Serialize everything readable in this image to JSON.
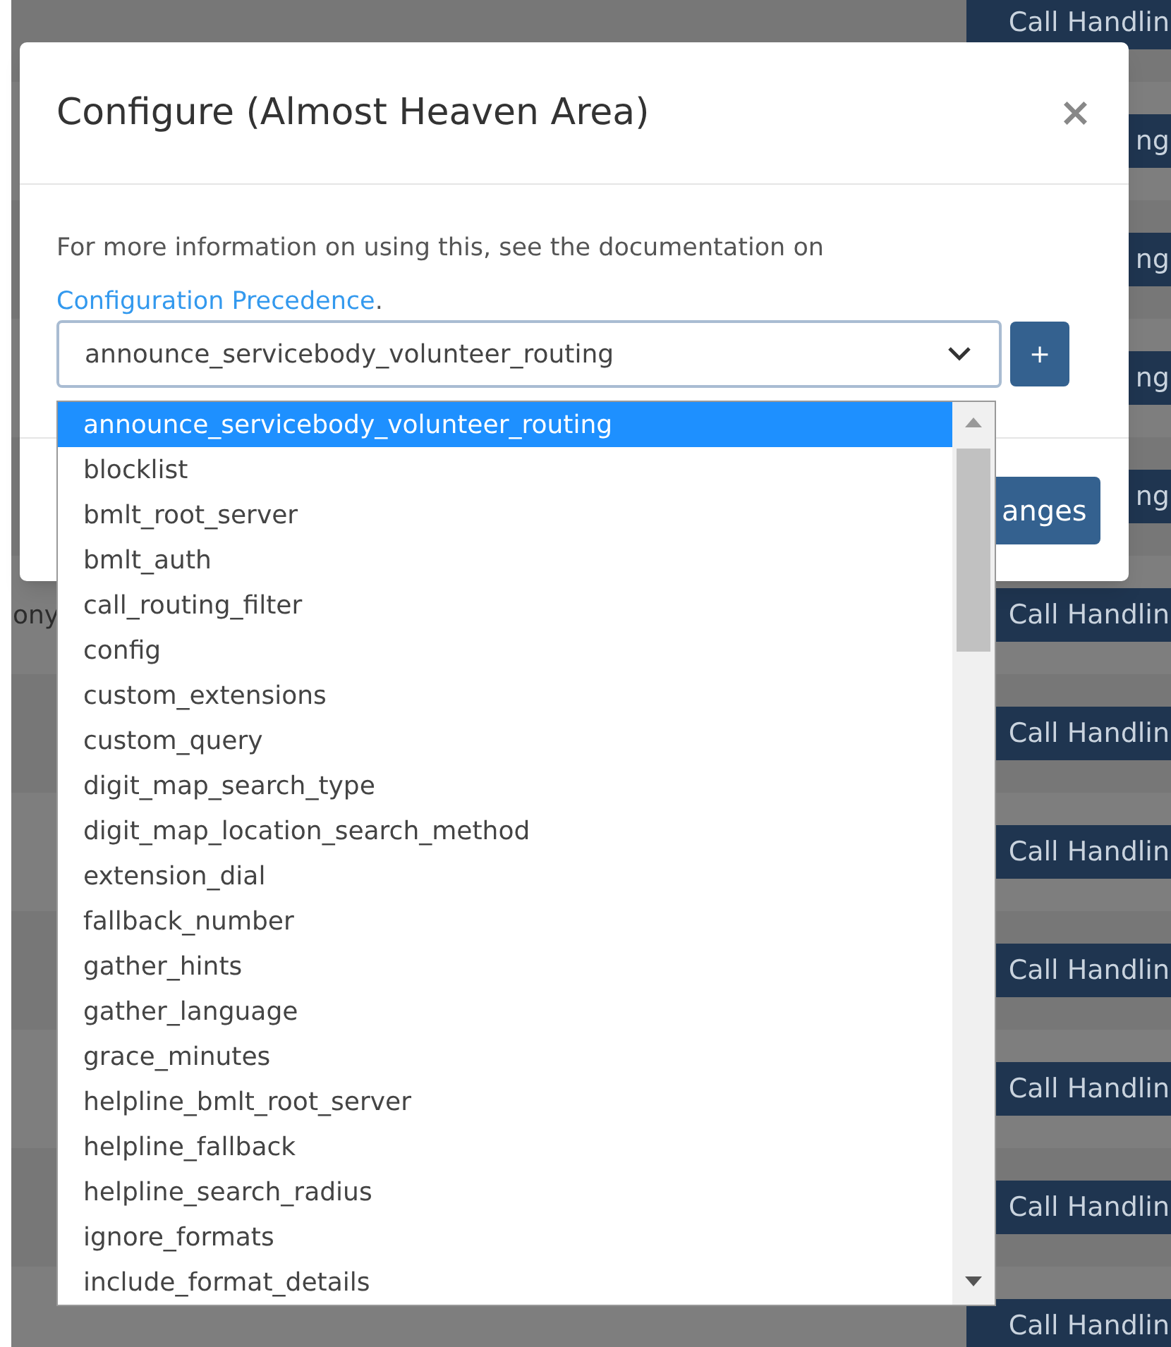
{
  "page_rows": [
    {
      "button": "Call Handlin"
    },
    {
      "button": "ng"
    },
    {
      "button": "ng"
    },
    {
      "button": "ng"
    },
    {
      "button": "ng"
    },
    {
      "text": "ony",
      "button": "Call Handlin"
    },
    {
      "button": "Call Handlin"
    },
    {
      "button": "Call Handlin"
    },
    {
      "button": "Call Handlin"
    },
    {
      "button": "Call Handlin"
    },
    {
      "button": "Call Handlin"
    },
    {
      "button": "Call Handlin"
    }
  ],
  "dialog": {
    "title": "Configure (Almost Heaven Area)",
    "close": "×",
    "description": "For more information on using this, see the documentation on",
    "link": "Configuration Precedence",
    "link_suffix": ".",
    "add_button": "+",
    "save_button": "anges",
    "select": {
      "value": "announce_servicebody_volunteer_routing",
      "options": [
        {
          "label": "announce_servicebody_volunteer_routing",
          "selected": true
        },
        {
          "label": "blocklist",
          "selected": false
        },
        {
          "label": "bmlt_root_server",
          "selected": false
        },
        {
          "label": "bmlt_auth",
          "selected": false
        },
        {
          "label": "call_routing_filter",
          "selected": false
        },
        {
          "label": "config",
          "selected": false
        },
        {
          "label": "custom_extensions",
          "selected": false
        },
        {
          "label": "custom_query",
          "selected": false
        },
        {
          "label": "digit_map_search_type",
          "selected": false
        },
        {
          "label": "digit_map_location_search_method",
          "selected": false
        },
        {
          "label": "extension_dial",
          "selected": false
        },
        {
          "label": "fallback_number",
          "selected": false
        },
        {
          "label": "gather_hints",
          "selected": false
        },
        {
          "label": "gather_language",
          "selected": false
        },
        {
          "label": "grace_minutes",
          "selected": false
        },
        {
          "label": "helpline_bmlt_root_server",
          "selected": false
        },
        {
          "label": "helpline_fallback",
          "selected": false
        },
        {
          "label": "helpline_search_radius",
          "selected": false
        },
        {
          "label": "ignore_formats",
          "selected": false
        },
        {
          "label": "include_format_details",
          "selected": false
        }
      ]
    }
  }
}
